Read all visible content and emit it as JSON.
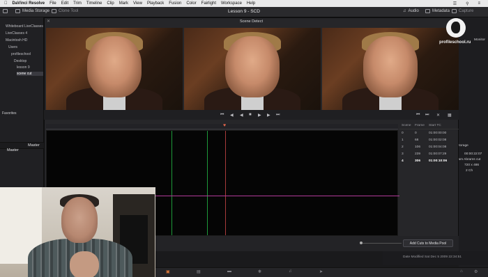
{
  "menubar": {
    "app": "DaVinci Resolve",
    "items": [
      "File",
      "Edit",
      "Trim",
      "Timeline",
      "Clip",
      "Mark",
      "View",
      "Playback",
      "Fusion",
      "Color",
      "Fairlight",
      "Workspace",
      "Help"
    ]
  },
  "toolbar": {
    "media_storage": "Media Storage",
    "clone_tool": "Clone Tool",
    "project_title": "Lesson 9 - SCD",
    "audio": "Audio",
    "metadata": "Metadata",
    "capture": "Capture"
  },
  "left_panel": {
    "tree": [
      {
        "label": "Whiteboard LiveClasses",
        "indent": 0
      },
      {
        "label": "LiveClasses 4",
        "indent": 0
      },
      {
        "label": "Macintosh HD",
        "indent": 0
      },
      {
        "label": "Users",
        "indent": 1
      },
      {
        "label": "profileschool",
        "indent": 2
      },
      {
        "label": "Desktop",
        "indent": 3
      },
      {
        "label": "lesson 9",
        "indent": 4
      },
      {
        "label": "scene cut",
        "indent": 4,
        "selected": true
      }
    ],
    "favorites_label": "Favorites",
    "master_label": "Master",
    "master_bin": "Master"
  },
  "dialog": {
    "title": "Scene Detect",
    "add_cuts_label": "Add Cuts to Media Pool"
  },
  "scene_table": {
    "headers": [
      "Scene",
      "Frame",
      "Start TC"
    ],
    "rows": [
      {
        "scene": "0",
        "frame": "0",
        "tc": "01:00:00:00"
      },
      {
        "scene": "1",
        "frame": "68",
        "tc": "01:00:02:08"
      },
      {
        "scene": "2",
        "frame": "106",
        "tc": "01:00:04:08"
      },
      {
        "scene": "3",
        "frame": "239",
        "tc": "01:00:07:29"
      },
      {
        "scene": "4",
        "frame": "306",
        "tc": "01:00:10:06",
        "selected": true
      }
    ]
  },
  "meta_panel": {
    "storage_label": "Storage",
    "monitor_label": "Monitor",
    "tc": "00:00:22:07",
    "clip_name": "sam Abrams cut",
    "resolution": "720 x 486",
    "channels": "2 Ch"
  },
  "date_modified": "Date Modified  Sat Dec 5 2009 22:34:51",
  "watermark": "profileschool.ru"
}
